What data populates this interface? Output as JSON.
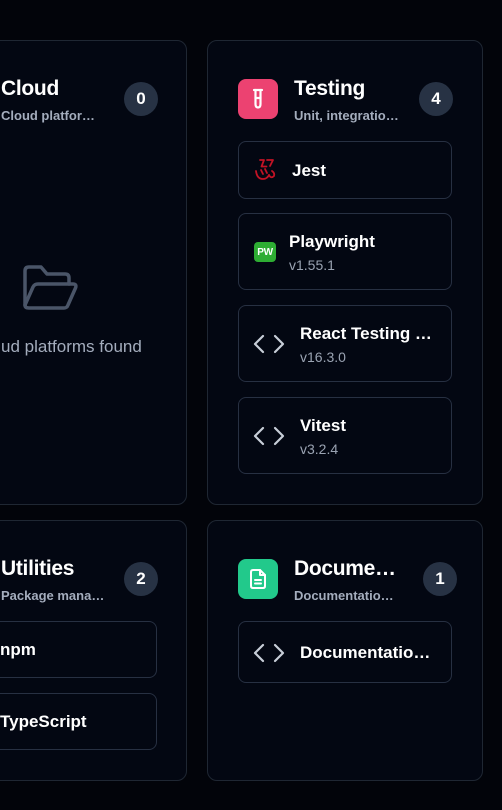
{
  "cloud": {
    "title": "Cloud",
    "subtitle": "Cloud platfor…",
    "count": "0",
    "empty_text": "ud platforms found",
    "empty_icon": "folder-open-icon"
  },
  "testing": {
    "title": "Testing",
    "subtitle": "Unit, integratio…",
    "count": "4",
    "accent": "#ec4271",
    "icon": "test-tube-icon",
    "items": [
      {
        "name": "Jest",
        "version": "",
        "icon": "jest-icon"
      },
      {
        "name": "Playwright",
        "version": "v1.55.1",
        "icon": "playwright-icon"
      },
      {
        "name": "React Testing …",
        "version": "v16.3.0",
        "icon": "code-icon"
      },
      {
        "name": "Vitest",
        "version": "v3.2.4",
        "icon": "code-icon"
      }
    ]
  },
  "utilities": {
    "title": "Utilities",
    "subtitle": "Package mana…",
    "count": "2",
    "items": [
      {
        "name": "npm"
      },
      {
        "name": "TypeScript"
      }
    ]
  },
  "documentation": {
    "title": "Docume…",
    "subtitle": "Documentatio…",
    "count": "1",
    "accent": "#22c98b",
    "icon": "document-icon",
    "items": [
      {
        "name": "Documentatio…",
        "icon": "code-icon"
      }
    ]
  },
  "colors": {
    "background": "#02040a",
    "card": "#030712",
    "border": "#1f2733",
    "badge": "#273244",
    "muted_text": "#a4adbd"
  }
}
